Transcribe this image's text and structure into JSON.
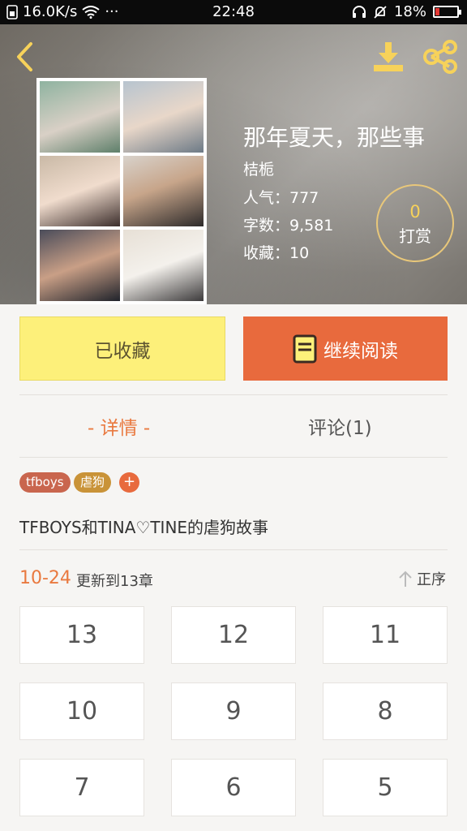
{
  "status_bar": {
    "net_speed": "16.0K/s",
    "more": "···",
    "time": "22:48",
    "battery_percent": "18%",
    "battery_level": 0.18,
    "battery_color": "#e53935"
  },
  "header": {
    "icons": {
      "back": "back-chevron-icon",
      "download": "download-icon",
      "share": "share-icon"
    },
    "accent_color": "#f7d25a"
  },
  "book": {
    "title": "那年夏天，那些事",
    "author": "桔栀",
    "popularity": "人气：777",
    "word_count": "字数：9,581",
    "favorites": "收藏：10",
    "tip_count": "0",
    "tip_label": "打赏"
  },
  "actions": {
    "favorite_label": "已收藏",
    "favorite_color": "#fdf07a",
    "read_label": "继续阅读",
    "read_color": "#e86a3d",
    "read_icon": "book-icon"
  },
  "tabs": {
    "detail": "- 详情 -",
    "comments": "评论(1)",
    "active_color": "#e9793f"
  },
  "tags": {
    "items": [
      "tfboys",
      "虐狗"
    ],
    "add_label": "+"
  },
  "description": "TFBOYS和TINA♡TINE的虐狗故事",
  "updates": {
    "date": "10-24",
    "text": "更新到13章",
    "sort_label": "正序",
    "sort_icon": "arrow-up-icon"
  },
  "chapters": [
    "13",
    "12",
    "11",
    "10",
    "9",
    "8",
    "7",
    "6",
    "5"
  ]
}
